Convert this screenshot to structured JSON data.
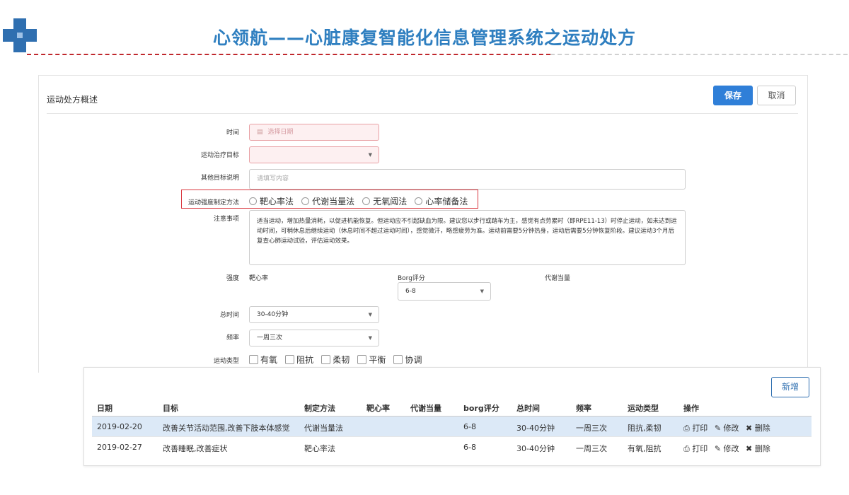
{
  "header": {
    "title": "心领航——心脏康复智能化信息管理系统之运动处方"
  },
  "form": {
    "panel_title": "运动处方概述",
    "save_label": "保存",
    "cancel_label": "取消",
    "time_label": "时间",
    "time_placeholder": "选择日期",
    "goal_label": "运动治疗目标",
    "other_label": "其他目标说明",
    "other_placeholder": "请填写内容",
    "method_label": "运动强度制定方法",
    "methods": [
      "靶心率法",
      "代谢当量法",
      "无氧阈法",
      "心率储备法"
    ],
    "notes_label": "注意事项",
    "notes_text": "适当运动，增加热量消耗，以促进机能恢复。但运动应不引起缺血为限。建议您以步行或踏车为主，感觉有点劳累时（即RPE11-13）时停止运动，如未达到运动时间，可稍休息后继续运动（休息时间不超过运动时间），感觉微汗，略感疲劳为准。运动前需要5分钟热身，运动后需要5分钟恢复阶段。建议运动3个月后复查心肺运动试验，评估运动效果。",
    "intensity_label": "强度",
    "target_hr_label": "靶心率",
    "borg_label": "Borg评分",
    "borg_value": "6-8",
    "met_label": "代谢当量",
    "total_time_label": "总时间",
    "total_time_value": "30-40分钟",
    "frequency_label": "频率",
    "frequency_value": "一周三次",
    "exercise_type_label": "运动类型",
    "exercise_types": [
      "有氧",
      "阻抗",
      "柔韧",
      "平衡",
      "协调"
    ]
  },
  "table": {
    "add_label": "新增",
    "columns": [
      "日期",
      "目标",
      "制定方法",
      "靶心率",
      "代谢当量",
      "borg评分",
      "总时间",
      "频率",
      "运动类型",
      "操作"
    ],
    "rows": [
      {
        "date": "2019-02-20",
        "goal": "改善关节活动范围,改善下肢本体感觉",
        "method": "代谢当量法",
        "target_hr": "",
        "met": "",
        "borg": "6-8",
        "total_time": "30-40分钟",
        "frequency": "一周三次",
        "type": "阻抗,柔韧"
      },
      {
        "date": "2019-02-27",
        "goal": "改善睡眠,改善症状",
        "method": "靶心率法",
        "target_hr": "",
        "met": "",
        "borg": "6-8",
        "total_time": "30-40分钟",
        "frequency": "一周三次",
        "type": "有氧,阻抗"
      }
    ],
    "actions": {
      "print": "打印",
      "edit": "修改",
      "delete": "删除"
    }
  }
}
